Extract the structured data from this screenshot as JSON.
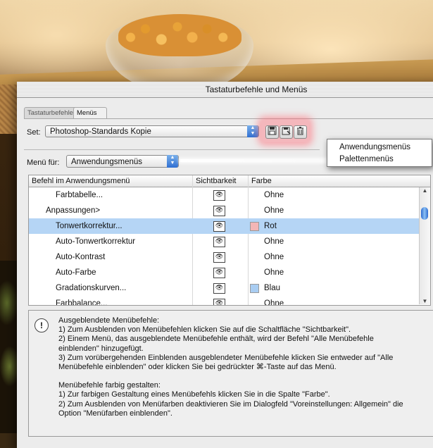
{
  "dialog": {
    "title": "Tastaturbefehle und Menüs"
  },
  "tabs": [
    {
      "label": "Tastaturbefehle",
      "active": false
    },
    {
      "label": "Menüs",
      "active": true
    }
  ],
  "set": {
    "label": "Set:",
    "value": "Photoshop-Standards Kopie"
  },
  "icons": {
    "save": "save-icon",
    "save_as": "save-as-icon",
    "delete": "trash-icon"
  },
  "menu_for": {
    "label": "Menü für:",
    "value": "Anwendungsmenüs",
    "options": [
      "Anwendungsmenüs",
      "Palettenmenüs"
    ]
  },
  "table": {
    "columns": [
      "Befehl im Anwendungsmenü",
      "Sichtbarkeit",
      "Farbe"
    ],
    "rows": [
      {
        "command": "Farbtabelle...",
        "color": "Ohne",
        "swatch": null
      },
      {
        "command": "Anpassungen>",
        "color": "Ohne",
        "swatch": null
      },
      {
        "command": "Tonwertkorrektur...",
        "color": "Rot",
        "swatch": "#f4b6b6",
        "selected": true
      },
      {
        "command": "Auto-Tonwertkorrektur",
        "color": "Ohne",
        "swatch": null
      },
      {
        "command": "Auto-Kontrast",
        "color": "Ohne",
        "swatch": null
      },
      {
        "command": "Auto-Farbe",
        "color": "Ohne",
        "swatch": null
      },
      {
        "command": "Gradationskurven...",
        "color": "Blau",
        "swatch": "#a9cdf2"
      },
      {
        "command": "Farbbalance...",
        "color": "Ohne",
        "swatch": null
      }
    ]
  },
  "info": {
    "hidden_heading": "Ausgeblendete Menübefehle:",
    "hidden_1": "1) Zum Ausblenden von Menübefehlen klicken Sie auf die Schaltfläche \"Sichtbarkeit\".",
    "hidden_2a": "2) Einem Menü, das ausgeblendete Menübefehle enthält, wird der Befehl \"Alle Menübefehle",
    "hidden_2b": "einblenden\" hinzugefügt.",
    "hidden_3a": "3) Zum vorübergehenden Einblenden ausgeblendeter Menübefehle klicken Sie entweder auf \"Alle",
    "hidden_3b": "Menübefehle einblenden\" oder klicken Sie bei gedrückter ⌘-Taste auf das Menü.",
    "color_heading": "Menübefehle farbig gestalten:",
    "color_1": "1) Zur farbigen Gestaltung eines Menübefehls klicken Sie in die Spalte \"Farbe\".",
    "color_2a": "2) Zum Ausblenden von Menüfarben deaktivieren Sie im Dialogfeld \"Voreinstellungen: Allgemein\" die",
    "color_2b": "Option \"Menüfarben einblenden\"."
  }
}
